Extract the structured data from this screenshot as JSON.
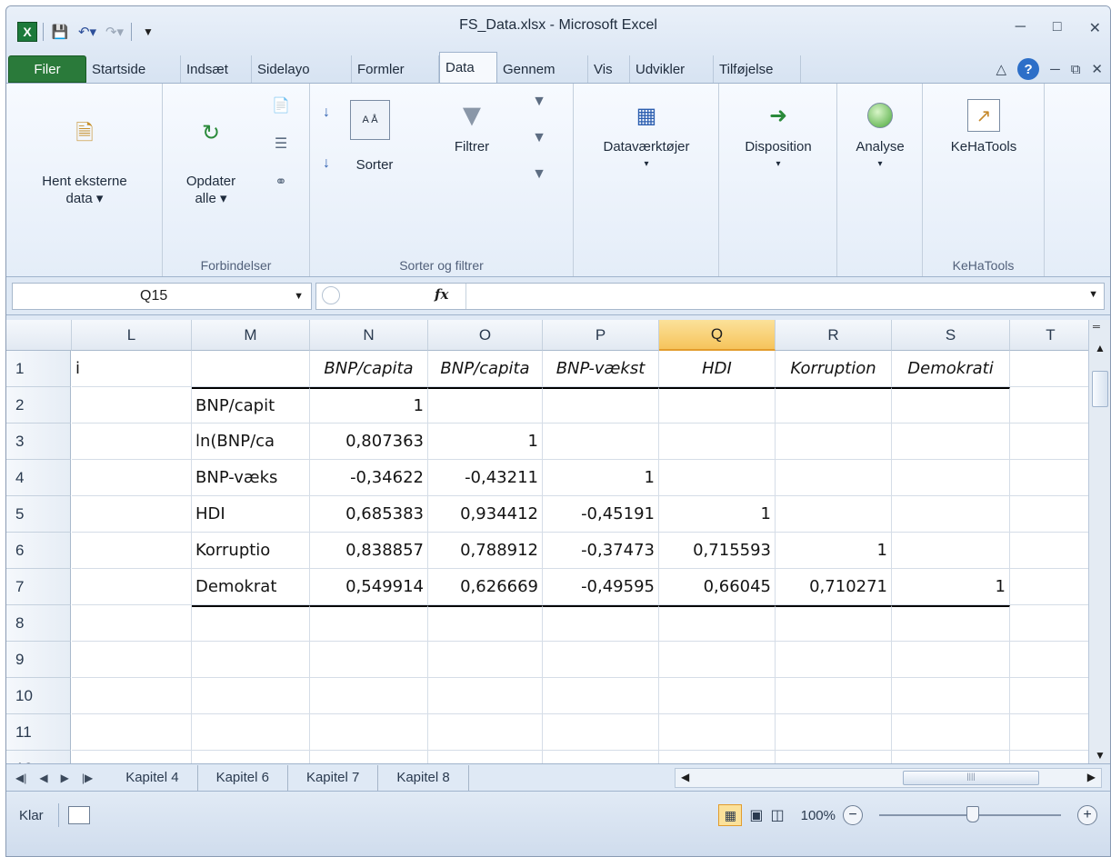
{
  "window": {
    "title": "FS_Data.xlsx - Microsoft Excel",
    "app_icon": "excel-logo-icon"
  },
  "tabs": [
    {
      "label": "Filer",
      "active": false
    },
    {
      "label": "Startside",
      "active": false
    },
    {
      "label": "Indsæt",
      "active": false
    },
    {
      "label": "Sidelayo",
      "active": false
    },
    {
      "label": "Formler",
      "active": false
    },
    {
      "label": "Data",
      "active": true
    },
    {
      "label": "Gennem",
      "active": false
    },
    {
      "label": "Vis",
      "active": false
    },
    {
      "label": "Udvikler",
      "active": false
    },
    {
      "label": "Tilføjelse",
      "active": false
    }
  ],
  "ribbon": {
    "external_data": "Hent eksterne\ndata ▾",
    "refresh": "Opdater\nalle ▾",
    "connections_group": "Forbindelser",
    "sort": "Sorter",
    "filter": "Filtrer",
    "sort_filter_group": "Sorter og filtrer",
    "data_tools": "Dataværktøjer",
    "outline": "Disposition",
    "analysis": "Analyse",
    "kehatools": "KeHaTools",
    "kehatools_group": "KeHaTools"
  },
  "formula_bar": {
    "name_box": "Q15",
    "fx": "fx",
    "formula": ""
  },
  "columns": [
    "L",
    "M",
    "N",
    "O",
    "P",
    "Q",
    "R",
    "S",
    "T"
  ],
  "selected_column": "Q",
  "rows": [
    "1",
    "2",
    "3",
    "4",
    "5",
    "6",
    "7",
    "8",
    "9",
    "10",
    "11",
    "12"
  ],
  "cells": {
    "L1": "i",
    "N1": "BNP/capita",
    "O1": "BNP/capita",
    "P1": "BNP-vækst",
    "Q1": "HDI",
    "R1": "Korruption",
    "S1": "Demokrati",
    "M2": "BNP/capit",
    "M3": "ln(BNP/ca",
    "M4": "BNP-væks",
    "M5": "HDI",
    "M6": "Korruptio",
    "M7": "Demokrat",
    "N2": "1",
    "N3": "0,807363",
    "N4": "-0,34622",
    "N5": "0,685383",
    "N6": "0,838857",
    "N7": "0,549914",
    "O3": "1",
    "O4": "-0,43211",
    "O5": "0,934412",
    "O6": "0,788912",
    "O7": "0,626669",
    "P4": "1",
    "P5": "-0,45191",
    "P6": "-0,37473",
    "P7": "-0,49595",
    "Q5": "1",
    "Q6": "0,715593",
    "Q7": "0,66045",
    "R6": "1",
    "R7": "0,710271",
    "S7": "1"
  },
  "sheet_tabs": [
    "Kapitel 4",
    "Kapitel 6",
    "Kapitel 7",
    "Kapitel 8"
  ],
  "status": {
    "ready": "Klar",
    "zoom": "100%"
  }
}
